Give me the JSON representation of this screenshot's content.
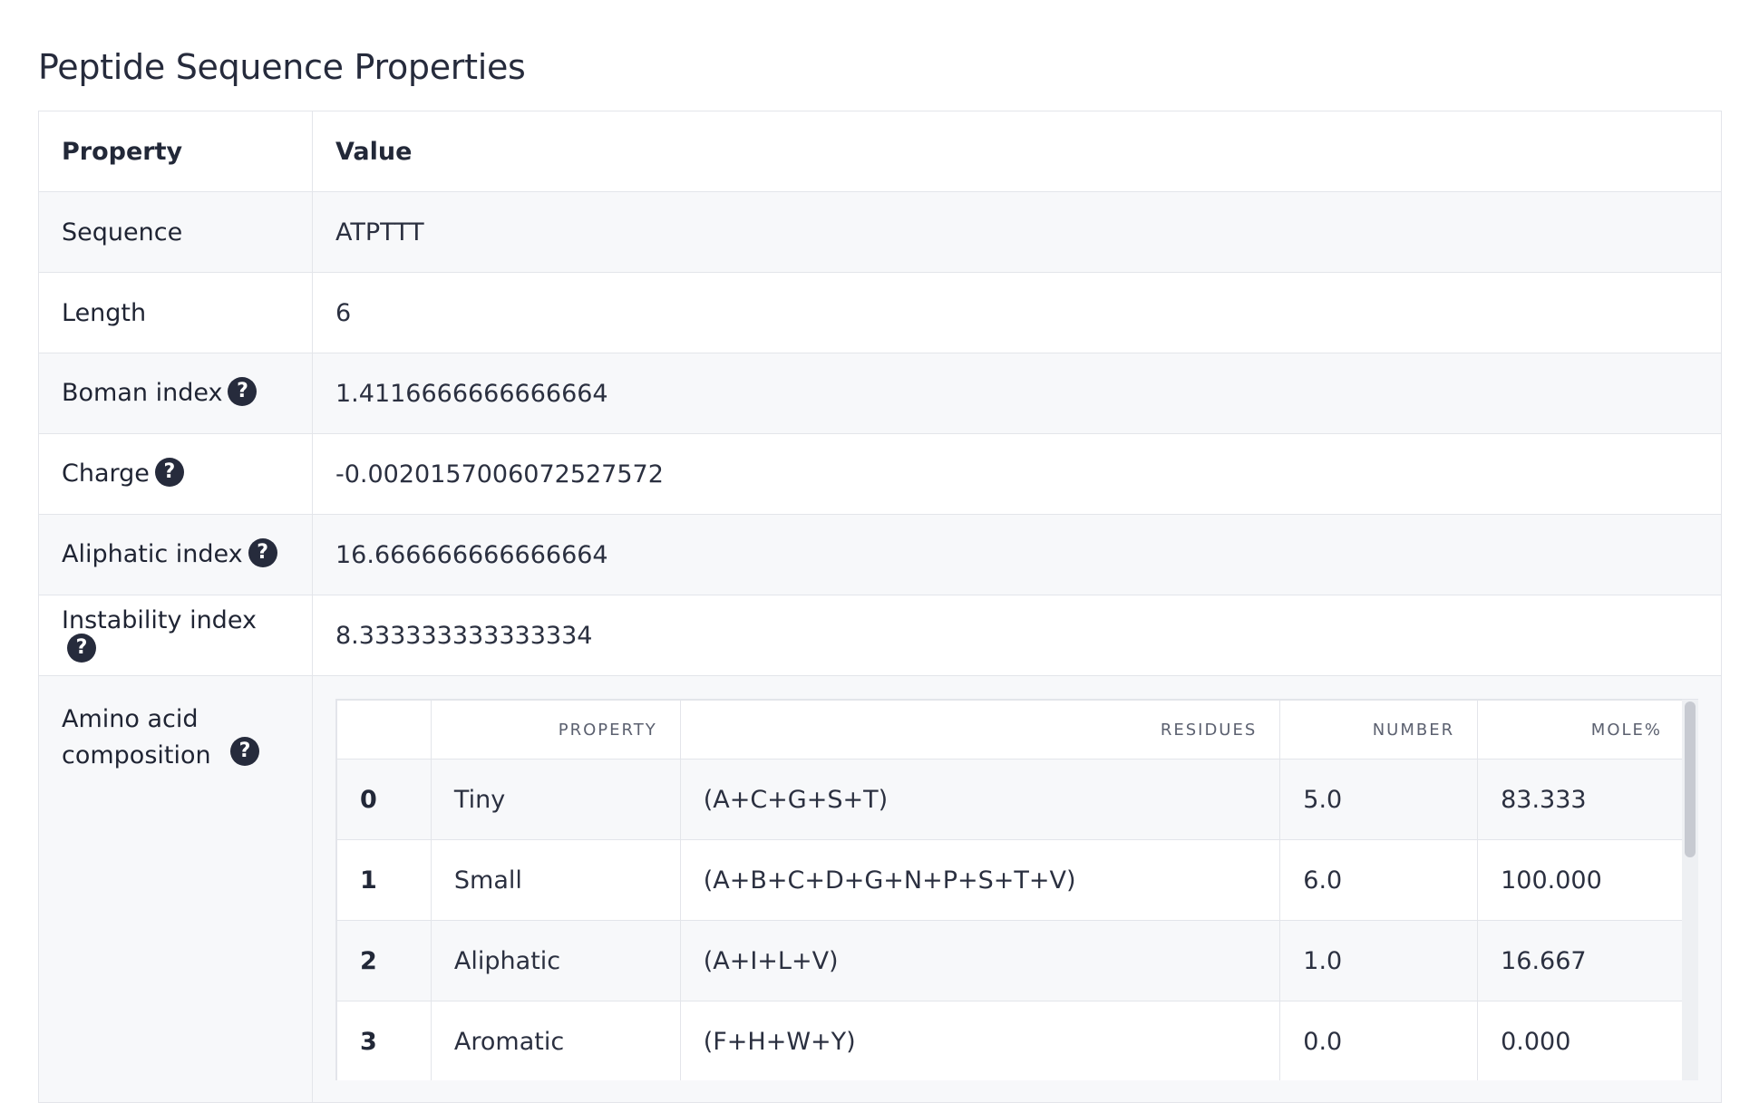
{
  "title": "Peptide Sequence Properties",
  "headers": {
    "property": "Property",
    "value": "Value"
  },
  "rows": [
    {
      "label": "Sequence",
      "value": "ATPTTT",
      "help": false
    },
    {
      "label": "Length",
      "value": "6",
      "help": false
    },
    {
      "label": "Boman index",
      "value": "1.4116666666666664",
      "help": true
    },
    {
      "label": "Charge",
      "value": "-0.0020157006072527572",
      "help": true
    },
    {
      "label": "Aliphatic index",
      "value": "16.666666666666664",
      "help": true
    },
    {
      "label": "Instability index",
      "value": "8.333333333333334",
      "help": true
    }
  ],
  "help_glyph": "?",
  "amino": {
    "label": "Amino acid composition",
    "columns": [
      "",
      "PROPERTY",
      "RESIDUES",
      "NUMBER",
      "MOLE%"
    ],
    "rows": [
      {
        "index": "0",
        "property": "Tiny",
        "residues": "(A+C+G+S+T)",
        "number": "5.0",
        "mole": "83.333"
      },
      {
        "index": "1",
        "property": "Small",
        "residues": "(A+B+C+D+G+N+P+S+T+V)",
        "number": "6.0",
        "mole": "100.000"
      },
      {
        "index": "2",
        "property": "Aliphatic",
        "residues": "(A+I+L+V)",
        "number": "1.0",
        "mole": "16.667"
      },
      {
        "index": "3",
        "property": "Aromatic",
        "residues": "(F+H+W+Y)",
        "number": "0.0",
        "mole": "0.000"
      }
    ]
  }
}
